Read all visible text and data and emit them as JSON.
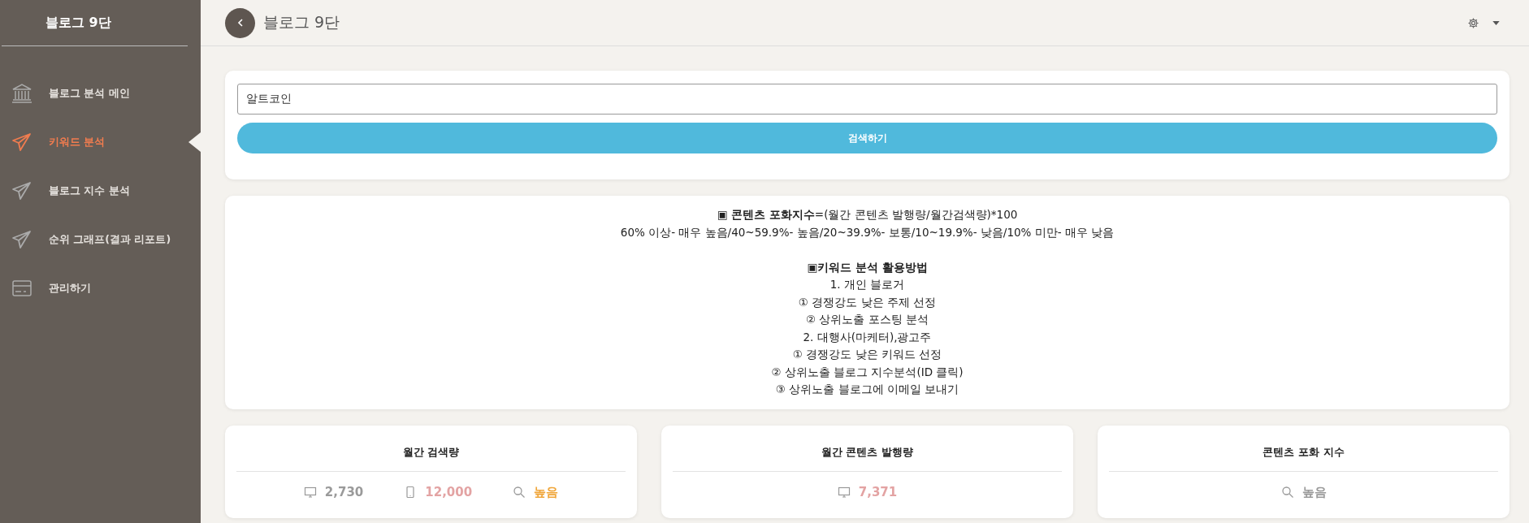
{
  "sidebar": {
    "title": "블로그 9단",
    "items": [
      {
        "kind": "bank",
        "label": "블로그 분석 메인",
        "selected": false
      },
      {
        "kind": "plane",
        "label": "키워드 분석",
        "selected": true
      },
      {
        "kind": "plane",
        "label": "블로그 지수 분석",
        "selected": false
      },
      {
        "kind": "plane",
        "label": "순위 그래프(결과 리포트)",
        "selected": false
      },
      {
        "kind": "card",
        "label": "관리하기",
        "selected": false
      }
    ]
  },
  "header": {
    "title": "블로그 9단"
  },
  "search": {
    "value": "알트코인",
    "button": "검색하기"
  },
  "info": [
    {
      "kind": "text",
      "text": "**▣ 콘텐츠 포화지수**=(월간 콘텐츠 발행량/월간검색량)*100"
    },
    {
      "kind": "text",
      "text": "60% 이상- 매우 높음/40~59.9%- 높음/20~39.9%- 보통/10~19.9%- 낮음/10% 미만- 매우 낮음"
    },
    {
      "kind": "heading",
      "text": "▣키워드 분석 활용방법"
    },
    {
      "kind": "text",
      "text": "1. 개인 블로거"
    },
    {
      "kind": "text",
      "text": "① 경쟁강도 낮은 주제 선정"
    },
    {
      "kind": "text",
      "text": "② 상위노출 포스팅 분석"
    },
    {
      "kind": "text",
      "text": "2. 대행사(마케터),광고주"
    },
    {
      "kind": "text",
      "text": "① 경쟁강도 낮은 키워드 선정"
    },
    {
      "kind": "text",
      "text": "② 상위노출 블로그 지수분석(ID 클릭)"
    },
    {
      "kind": "text",
      "text": "③ 상위노출 블로그에 이메일 보내기"
    }
  ],
  "cards": [
    {
      "title": "월간 검색량",
      "stats": [
        {
          "kind": "monitor",
          "value": "2,730",
          "color": "#9a9a9a"
        },
        {
          "kind": "phone",
          "value": "12,000",
          "color": "#e3a3a3"
        },
        {
          "kind": "search",
          "value": "높음",
          "color": "#f0a63a"
        }
      ]
    },
    {
      "title": "월간 콘텐츠 발행량",
      "stats": [
        {
          "kind": "monitor",
          "value": "7,371",
          "color": "#e3a3a3"
        }
      ]
    },
    {
      "title": "콘텐츠 포화 지수",
      "stats": [
        {
          "kind": "search",
          "value": "높음",
          "color": "#9a9a9a"
        }
      ]
    }
  ]
}
